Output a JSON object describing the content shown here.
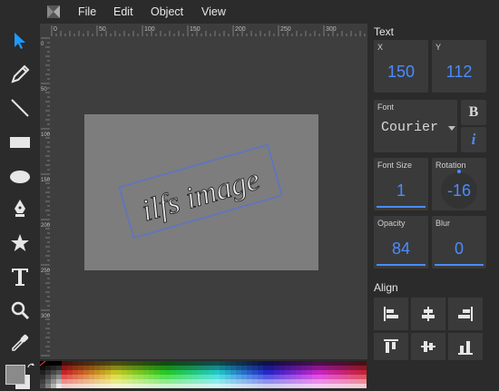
{
  "menu": {
    "items": [
      "File",
      "Edit",
      "Object",
      "View"
    ]
  },
  "ruler": {
    "top_ticks": [
      "0",
      "50",
      "100",
      "150",
      "200",
      "250",
      "300"
    ],
    "left_ticks": [
      "0",
      "50",
      "100",
      "150",
      "200",
      "250",
      "300",
      "350"
    ]
  },
  "canvas": {
    "text": "ilfs image",
    "font": "Courier",
    "rotation_deg": -16,
    "opacity_pct": 84
  },
  "panel": {
    "text_title": "Text",
    "x_label": "X",
    "x_value": "150",
    "y_label": "Y",
    "y_value": "112",
    "font_label": "Font",
    "font_value": "Courier",
    "bold_label": "B",
    "italic_label": "i",
    "font_size_label": "Font Size",
    "font_size_value": "1",
    "rotation_label": "Rotation",
    "rotation_value": "-16",
    "opacity_label": "Opacity",
    "opacity_value": "84",
    "blur_label": "Blur",
    "blur_value": "0",
    "align_title": "Align"
  },
  "tools": [
    "pointer-icon",
    "pencil-icon",
    "line-icon",
    "rectangle-icon",
    "ellipse-icon",
    "pen-icon",
    "star-icon",
    "text-icon",
    "zoom-icon",
    "eyedropper-icon"
  ],
  "colors": {
    "accent": "#4a8cff",
    "canvas": "#7d7d7d",
    "workspace": "#3e3e3e",
    "panel_box": "#3a3a3a"
  }
}
